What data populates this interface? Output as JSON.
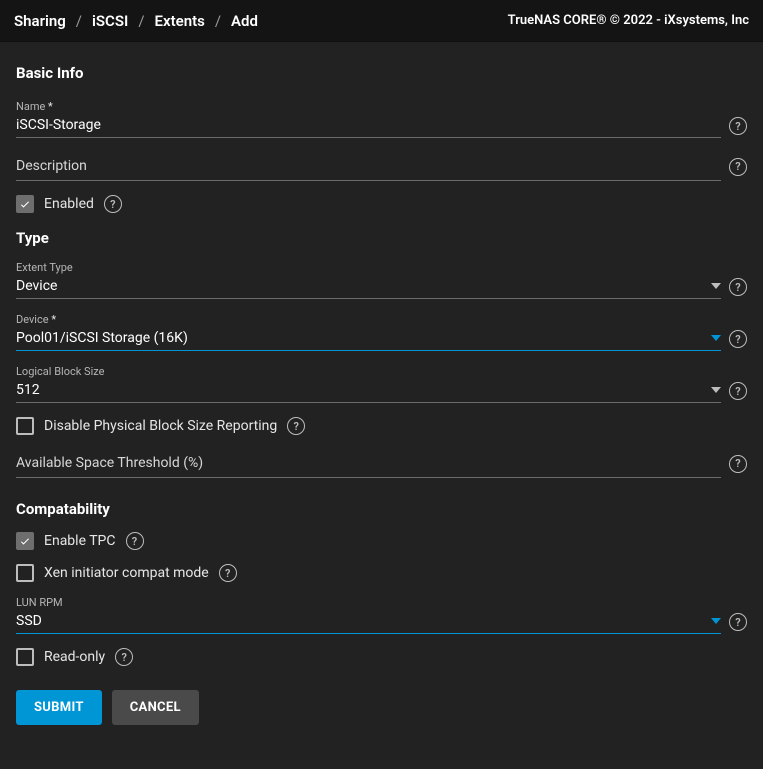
{
  "breadcrumb": [
    "Sharing",
    "iSCSI",
    "Extents",
    "Add"
  ],
  "copyright": "TrueNAS CORE® © 2022 - iXsystems, Inc",
  "sections": {
    "basic": "Basic Info",
    "type": "Type",
    "compat": "Compatability"
  },
  "fields": {
    "name": {
      "label": "Name",
      "required": "*",
      "value": "iSCSI-Storage"
    },
    "description": {
      "label": "Description",
      "value": ""
    },
    "enabled": {
      "label": "Enabled",
      "checked": true
    },
    "extentType": {
      "label": "Extent Type",
      "value": "Device"
    },
    "device": {
      "label": "Device",
      "required": "*",
      "value": "Pool01/iSCSI Storage (16K)"
    },
    "lbs": {
      "label": "Logical Block Size",
      "value": "512"
    },
    "disablePBS": {
      "label": "Disable Physical Block Size Reporting",
      "checked": false
    },
    "threshold": {
      "label": "Available Space Threshold (%)",
      "value": ""
    },
    "enableTPC": {
      "label": "Enable TPC",
      "checked": true
    },
    "xen": {
      "label": "Xen initiator compat mode",
      "checked": false
    },
    "lunrpm": {
      "label": "LUN RPM",
      "value": "SSD"
    },
    "readonly": {
      "label": "Read-only",
      "checked": false
    }
  },
  "buttons": {
    "submit": "SUBMIT",
    "cancel": "CANCEL"
  }
}
